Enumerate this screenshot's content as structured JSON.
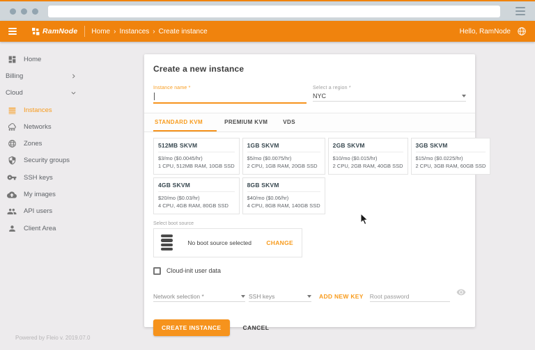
{
  "browser": {
    "url_value": ""
  },
  "header": {
    "logo": "RamNode",
    "breadcrumb": {
      "items": [
        "Home",
        "Instances",
        "Create instance"
      ],
      "separator": "›"
    },
    "greeting": "Hello, RamNode"
  },
  "sidebar": {
    "items": [
      {
        "label": "Home",
        "icon": "dashboard-icon"
      },
      {
        "label": "Billing",
        "icon": "chevron-right-icon"
      },
      {
        "label": "Cloud",
        "icon": "chevron-down-icon"
      },
      {
        "label": "Instances",
        "icon": "instances-icon",
        "active": true
      },
      {
        "label": "Networks",
        "icon": "networks-icon"
      },
      {
        "label": "Zones",
        "icon": "zones-icon"
      },
      {
        "label": "Security groups",
        "icon": "security-groups-icon"
      },
      {
        "label": "SSH keys",
        "icon": "ssh-keys-icon"
      },
      {
        "label": "My images",
        "icon": "my-images-icon"
      },
      {
        "label": "API users",
        "icon": "api-users-icon"
      },
      {
        "label": "Client Area",
        "icon": "client-area-icon"
      }
    ]
  },
  "main": {
    "title": "Create a new instance",
    "instance_name": {
      "label": "Instance name *",
      "value": ""
    },
    "region": {
      "label": "Select a region *",
      "value": "NYC"
    },
    "tabs": [
      {
        "label": "STANDARD KVM",
        "active": true
      },
      {
        "label": "PREMIUM KVM",
        "active": false
      },
      {
        "label": "VDS",
        "active": false
      }
    ],
    "plans": [
      {
        "name": "512MB SKVM",
        "price": "$3/mo ($0.0045/hr)",
        "specs": "1 CPU, 512MB RAM, 10GB SSD"
      },
      {
        "name": "1GB SKVM",
        "price": "$5/mo ($0.0075/hr)",
        "specs": "2 CPU, 1GB RAM, 20GB SSD"
      },
      {
        "name": "2GB SKVM",
        "price": "$10/mo ($0.015/hr)",
        "specs": "2 CPU, 2GB RAM, 40GB SSD"
      },
      {
        "name": "3GB SKVM",
        "price": "$15/mo ($0.0225/hr)",
        "specs": "2 CPU, 3GB RAM, 60GB SSD"
      },
      {
        "name": "4GB SKVM",
        "price": "$20/mo ($0.03/hr)",
        "specs": "4 CPU, 4GB RAM, 80GB SSD"
      },
      {
        "name": "8GB SKVM",
        "price": "$40/mo ($0.06/hr)",
        "specs": "4 CPU, 8GB RAM, 140GB SSD"
      }
    ],
    "boot_source": {
      "label": "Select boot source",
      "status": "No boot source selected",
      "change_label": "CHANGE"
    },
    "cloud_init": {
      "label": "Cloud-init user data",
      "checked": false
    },
    "network": {
      "label": "Network selection *"
    },
    "ssh_keys": {
      "label": "SSH keys"
    },
    "add_new_key_label": "ADD NEW KEY",
    "root_password": {
      "placeholder": "Root password"
    },
    "actions": {
      "create_label": "CREATE INSTANCE",
      "cancel_label": "CANCEL"
    }
  },
  "footer": {
    "text": "Powered by Fleio v. 2019.07.0"
  },
  "colors": {
    "header_orange": "#f0830d",
    "accent_orange": "#f6931d",
    "link_orange": "#f89b1c"
  }
}
